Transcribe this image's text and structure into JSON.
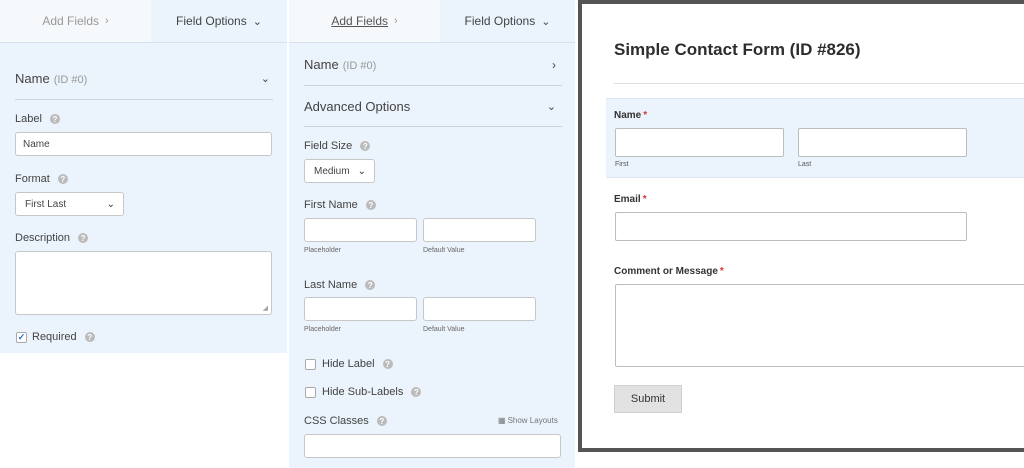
{
  "panel1": {
    "tabs": {
      "add_fields": "Add Fields",
      "field_options": "Field Options"
    },
    "section_title": "Name",
    "section_id": "(ID #0)",
    "label_title": "Label",
    "label_value": "Name",
    "format_title": "Format",
    "format_value": "First Last",
    "description_title": "Description",
    "required_label": "Required",
    "required_checked": true
  },
  "panel2": {
    "tabs": {
      "add_fields": "Add Fields",
      "field_options": "Field Options"
    },
    "section_title": "Name",
    "section_id": "(ID #0)",
    "advanced_title": "Advanced Options",
    "field_size_title": "Field Size",
    "field_size_value": "Medium",
    "first_name_title": "First Name",
    "last_name_title": "Last Name",
    "placeholder_label": "Placeholder",
    "default_value_label": "Default Value",
    "hide_label": "Hide Label",
    "hide_sublabels": "Hide Sub-Labels",
    "css_classes_title": "CSS Classes",
    "show_layouts": "Show Layouts"
  },
  "preview": {
    "form_title": "Simple Contact Form (ID #826)",
    "name_label": "Name",
    "first_sub": "First",
    "last_sub": "Last",
    "email_label": "Email",
    "message_label": "Comment or Message",
    "required_marker": "*",
    "submit_label": "Submit"
  },
  "icons": {
    "help": "question-circle-icon",
    "chevron_right": "chevron-right-icon",
    "chevron_down": "chevron-down-icon",
    "check": "checkmark-icon",
    "layout_grid": "grid-icon"
  },
  "colors": {
    "panel_bg": "#ebf3fc",
    "required": "#d63638",
    "check": "#1e6fd1"
  }
}
